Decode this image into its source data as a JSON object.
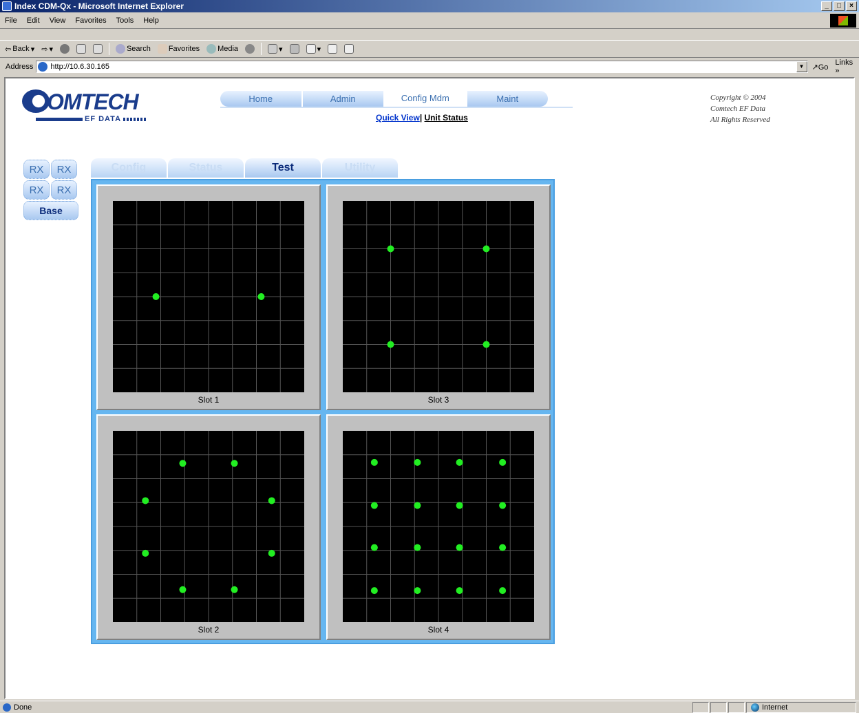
{
  "window": {
    "title": "Index CDM-Qx - Microsoft Internet Explorer",
    "min": "_",
    "max": "□",
    "close": "×"
  },
  "menu": [
    "File",
    "Edit",
    "View",
    "Favorites",
    "Tools",
    "Help"
  ],
  "toolbar": {
    "back": "Back",
    "search": "Search",
    "favorites": "Favorites",
    "media": "Media"
  },
  "address": {
    "label": "Address",
    "url": "http://10.6.30.165",
    "go": "Go",
    "links": "Links »"
  },
  "logo": {
    "brand": "OMTECH",
    "sub": "EF DATA"
  },
  "nav": {
    "tabs": [
      "Home",
      "Admin",
      "Config Mdm",
      "Maint"
    ],
    "active": "Config Mdm"
  },
  "sublinks": {
    "quick_view": "Quick View",
    "sep": "|",
    "unit_status": "Unit Status"
  },
  "copyright": {
    "line1": "Copyright © 2004",
    "line2": "Comtech EF Data",
    "line3": "All Rights Reserved"
  },
  "side": {
    "rx": [
      "RX",
      "RX",
      "RX",
      "RX"
    ],
    "base": "Base"
  },
  "subtabs": [
    "Config",
    "Status",
    "Test",
    "Utility"
  ],
  "active_subtab": "Test",
  "constellations": [
    {
      "label": "Slot 1",
      "points": [
        [
          -0.55,
          0
        ],
        [
          0.55,
          0
        ]
      ]
    },
    {
      "label": "Slot 3",
      "points": [
        [
          -0.5,
          0.5
        ],
        [
          0.5,
          0.5
        ],
        [
          -0.5,
          -0.5
        ],
        [
          0.5,
          -0.5
        ]
      ]
    },
    {
      "label": "Slot 2",
      "points": [
        [
          -0.27,
          0.66
        ],
        [
          0.27,
          0.66
        ],
        [
          -0.66,
          0.27
        ],
        [
          0.66,
          0.27
        ],
        [
          -0.66,
          -0.28
        ],
        [
          0.66,
          -0.28
        ],
        [
          -0.27,
          -0.66
        ],
        [
          0.27,
          -0.66
        ]
      ]
    },
    {
      "label": "Slot 4",
      "points": [
        [
          -0.67,
          0.67
        ],
        [
          -0.22,
          0.67
        ],
        [
          0.22,
          0.67
        ],
        [
          0.67,
          0.67
        ],
        [
          -0.67,
          0.22
        ],
        [
          -0.22,
          0.22
        ],
        [
          0.22,
          0.22
        ],
        [
          0.67,
          0.22
        ],
        [
          -0.67,
          -0.22
        ],
        [
          -0.22,
          -0.22
        ],
        [
          0.22,
          -0.22
        ],
        [
          0.67,
          -0.22
        ],
        [
          -0.67,
          -0.67
        ],
        [
          -0.22,
          -0.67
        ],
        [
          0.22,
          -0.67
        ],
        [
          0.67,
          -0.67
        ]
      ]
    }
  ],
  "status": {
    "text": "Done",
    "zone": "Internet"
  }
}
